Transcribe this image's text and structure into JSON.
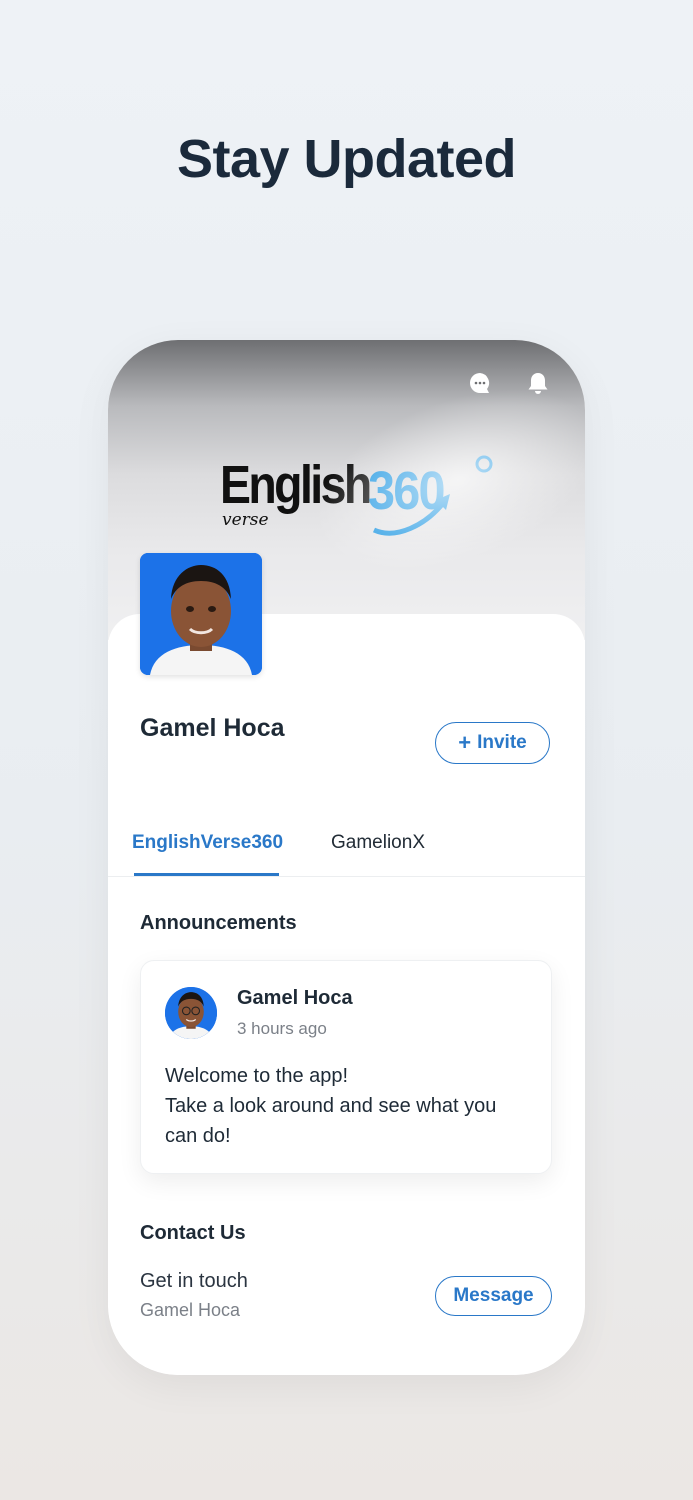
{
  "headline": "Stay Updated",
  "header": {
    "icons": [
      "chat-icon",
      "bell-icon"
    ],
    "logo": {
      "main": "English",
      "number": "360",
      "sub": "verse",
      "accent_color": "#2a9de4"
    }
  },
  "profile": {
    "name": "Gamel Hoca",
    "invite_label": "Invite",
    "invite_icon": "+"
  },
  "tabs": [
    {
      "label": "EnglishVerse360",
      "active": true
    },
    {
      "label": "GamelionX",
      "active": false
    }
  ],
  "announcements": {
    "title": "Announcements",
    "post": {
      "author": "Gamel Hoca",
      "time": "3 hours ago",
      "lines": [
        "Welcome to the app!",
        "Take a look around and see what you",
        "can do!"
      ]
    }
  },
  "contact": {
    "title": "Contact Us",
    "line": "Get in touch",
    "name": "Gamel Hoca",
    "button_label": "Message"
  },
  "colors": {
    "accent": "#2a78c8",
    "text_dark": "#1e2a36",
    "muted": "#7b8088"
  }
}
